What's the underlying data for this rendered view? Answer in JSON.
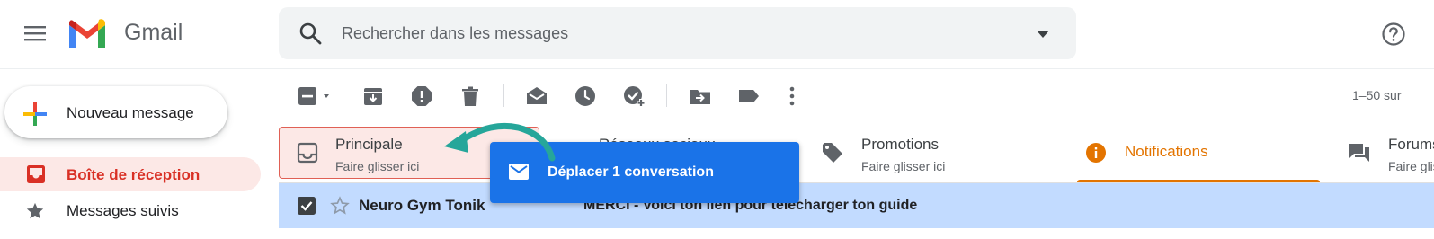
{
  "app": {
    "brand": "Gmail"
  },
  "search": {
    "placeholder": "Rechercher dans les messages"
  },
  "compose": {
    "label": "Nouveau message"
  },
  "nav": {
    "items": [
      {
        "label": "Boîte de réception",
        "icon": "inbox-icon",
        "active": true
      },
      {
        "label": "Messages suivis",
        "icon": "star-icon",
        "active": false
      }
    ]
  },
  "toolbar": {
    "pager": "1–50 sur",
    "buttons": [
      "select-checkbox",
      "archive",
      "report-spam",
      "delete",
      "mark-as-read",
      "snooze",
      "add-to-tasks",
      "move-to",
      "label",
      "more"
    ]
  },
  "tabs": [
    {
      "title": "Principale",
      "subtitle": "Faire glisser ici",
      "icon": "inbox-icon"
    },
    {
      "title": "Réseaux sociaux",
      "subtitle": "",
      "icon": "people-icon"
    },
    {
      "title": "Promotions",
      "subtitle": "Faire glisser ici",
      "icon": "tag-icon"
    },
    {
      "title": "Notifications",
      "subtitle": "",
      "icon": "info-icon",
      "selected": true
    },
    {
      "title": "Forums",
      "subtitle": "Faire glisser ici",
      "icon": "forum-icon"
    }
  ],
  "message_row": {
    "sender": "Neuro Gym Tonik",
    "subject": "MERCI - Voici ton lien pour télécharger ton guide",
    "selected": true
  },
  "drag_tooltip": {
    "label": "Déplacer 1 conversation"
  },
  "colors": {
    "accent_red": "#d93025",
    "notifications_orange": "#e37400",
    "drag_blue": "#1a73e8",
    "selected_row": "#c2dbff",
    "arrow_teal": "#26a69a"
  }
}
